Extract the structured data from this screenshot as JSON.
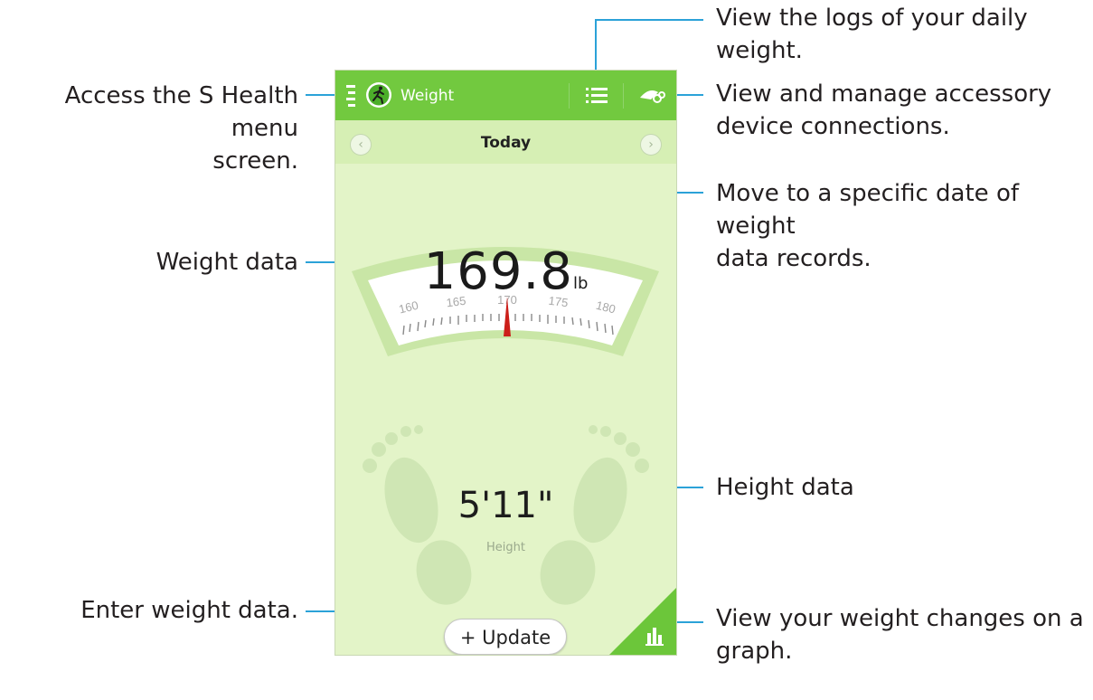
{
  "app": {
    "title": "Weight",
    "date_label": "Today",
    "weight_value": "169.8",
    "weight_unit": "lb",
    "scale_ticks": [
      "160",
      "165",
      "170",
      "175",
      "180"
    ],
    "height_value": "5'11\"",
    "height_label": "Height",
    "update_button": "+ Update",
    "accent": "#72c93f"
  },
  "callouts": {
    "menu": [
      "Access the S Health menu",
      "screen."
    ],
    "logs": [
      "View the logs of your daily",
      "weight."
    ],
    "accessory": [
      "View and manage accessory",
      "device connections."
    ],
    "date": [
      "Move to a specific date of weight",
      "data records."
    ],
    "weight": "Weight data",
    "height": "Height data",
    "enter": "Enter weight data.",
    "graph": [
      "View your weight changes on a",
      "graph."
    ]
  }
}
